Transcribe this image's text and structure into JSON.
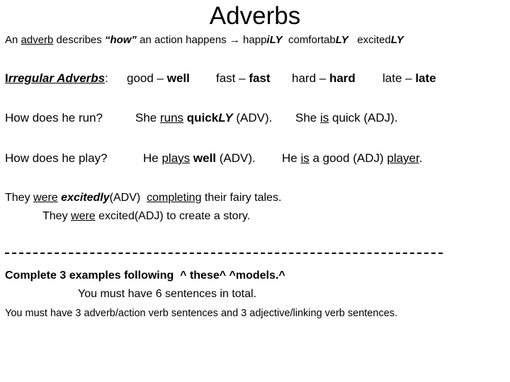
{
  "title": "Adverbs",
  "intro": {
    "part1": "An ",
    "adverb": "adverb",
    "part2": " describes ",
    "how": "“how”",
    "part3": " an action happens ",
    "arrow": "→",
    "ex1_stem": " happ",
    "ex1_suffix": "iLY",
    "ex2_stem": "  comfortab",
    "ex2_suffix": "LY",
    "ex3_stem": "   excited",
    "ex3_suffix": "LY"
  },
  "irregular": {
    "label_first": "I",
    "label_rest": "rregular Adverbs",
    "colon": ":",
    "pairs": [
      {
        "base": "good – ",
        "adverb": "well"
      },
      {
        "base": "fast – ",
        "adverb": "fast"
      },
      {
        "base": "hard – ",
        "adverb": "hard"
      },
      {
        "base": "late – ",
        "adverb": "late"
      }
    ]
  },
  "run": {
    "question": "How does he run?",
    "adv_subject": "She ",
    "adv_verb": "runs",
    "adv_word_stem": "quick",
    "adv_word_suffix": "LY",
    "adv_tag": " (ADV).",
    "adj_subject": "She ",
    "adj_verb": "is",
    "adj_rest": " quick (ADJ)."
  },
  "play": {
    "question": "How does he play?",
    "adv_subject": "He ",
    "adv_verb": "plays",
    "adv_word": "well",
    "adv_tag": " (ADV).",
    "adj_subject": "He ",
    "adj_verb": "is",
    "adj_rest": " a good (ADJ) ",
    "adj_noun": "player",
    "adj_end": "."
  },
  "fairy": {
    "line1_a": "They ",
    "line1_verb": "were",
    "line1_adv": "excitedly",
    "line1_tag": "(ADV)  ",
    "line1_participle": "completing",
    "line1_rest": " their fairy tales.",
    "line2_a": "They ",
    "line2_verb": "were",
    "line2_rest": " excited(ADJ) to create a story."
  },
  "instructions": {
    "complete": "Complete 3 examples following  ^ these^ ^models.^",
    "six": "You must have 6 sentences in total.",
    "detail": "You must have 3 adverb/action verb sentences and 3 adjective/linking verb sentences."
  }
}
